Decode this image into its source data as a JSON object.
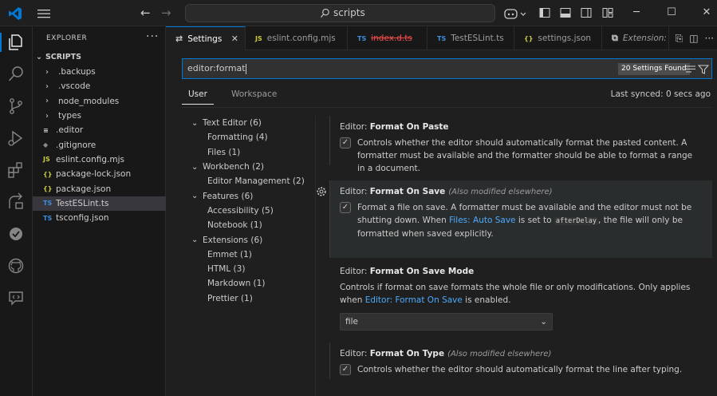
{
  "window": {
    "search_text": "scripts",
    "colors": {
      "accent": "#0078d4",
      "link": "#4daafc",
      "background": "#1f1f1f"
    }
  },
  "explorer": {
    "title": "EXPLORER",
    "section": "SCRIPTS",
    "items": [
      {
        "label": ".backups",
        "kind": "folder"
      },
      {
        "label": ".vscode",
        "kind": "folder"
      },
      {
        "label": "node_modules",
        "kind": "folder"
      },
      {
        "label": "types",
        "kind": "folder"
      },
      {
        "label": ".editor",
        "kind": "file",
        "icon_text": "≡"
      },
      {
        "label": ".gitignore",
        "kind": "file",
        "icon_text": "◆"
      },
      {
        "label": "eslint.config.mjs",
        "kind": "file",
        "icon_text": "JS"
      },
      {
        "label": "package-lock.json",
        "kind": "file",
        "icon_text": "{}"
      },
      {
        "label": "package.json",
        "kind": "file",
        "icon_text": "{}"
      },
      {
        "label": "TestESLint.ts",
        "kind": "file",
        "icon_text": "TS",
        "selected": true
      },
      {
        "label": "tsconfig.json",
        "kind": "file",
        "icon_text": "TS"
      }
    ]
  },
  "tabs": [
    {
      "label": "Settings",
      "icon": "settings-icon",
      "active": true
    },
    {
      "label": "eslint.config.mjs",
      "icon_text": "JS"
    },
    {
      "label": "index.d.ts",
      "icon_text": "TS",
      "error": true
    },
    {
      "label": "TestESLint.ts",
      "icon_text": "TS"
    },
    {
      "label": "settings.json",
      "icon_text": "{}"
    },
    {
      "label": "Extension: P",
      "icon": "extension-icon"
    }
  ],
  "settings": {
    "search_value": "editor:format",
    "found_badge": "20 Settings Found",
    "scopes": [
      "User",
      "Workspace"
    ],
    "last_synced": "Last synced: 0 secs ago",
    "toc": [
      {
        "label": "Text Editor (6)",
        "level": 0
      },
      {
        "label": "Formatting (4)",
        "level": 1
      },
      {
        "label": "Files (1)",
        "level": 1
      },
      {
        "label": "Workbench (2)",
        "level": 0
      },
      {
        "label": "Editor Management (2)",
        "level": 1
      },
      {
        "label": "Features (6)",
        "level": 0
      },
      {
        "label": "Accessibility (5)",
        "level": 1
      },
      {
        "label": "Notebook (1)",
        "level": 1
      },
      {
        "label": "Extensions (6)",
        "level": 0
      },
      {
        "label": "Emmet (1)",
        "level": 1
      },
      {
        "label": "HTML (3)",
        "level": 1
      },
      {
        "label": "Markdown (1)",
        "level": 1
      },
      {
        "label": "Prettier (1)",
        "level": 1
      }
    ],
    "items": {
      "paste": {
        "category": "Editor: ",
        "name": "Format On Paste",
        "checked": true,
        "description": "Controls whether the editor should automatically format the pasted content. A formatter must be available and the formatter should be able to format a range in a document."
      },
      "save": {
        "category": "Editor: ",
        "name": "Format On Save",
        "modified": "(Also modified elsewhere)",
        "checked": true,
        "desc_1": "Format a file on save. A formatter must be available and the editor must not be shutting down. When ",
        "desc_link": "Files: Auto Save",
        "desc_2": " is set to ",
        "desc_code": "afterDelay",
        "desc_3": ", the file will only be formatted when saved explicitly."
      },
      "save_mode": {
        "category": "Editor: ",
        "name": "Format On Save Mode",
        "desc_1": "Controls if format on save formats the whole file or only modifications. Only applies when ",
        "desc_link": "Editor: Format On Save",
        "desc_2": " is enabled.",
        "value": "file"
      },
      "type": {
        "category": "Editor: ",
        "name": "Format On Type",
        "modified": "(Also modified elsewhere)",
        "checked": true,
        "description": "Controls whether the editor should automatically format the line after typing."
      }
    }
  }
}
